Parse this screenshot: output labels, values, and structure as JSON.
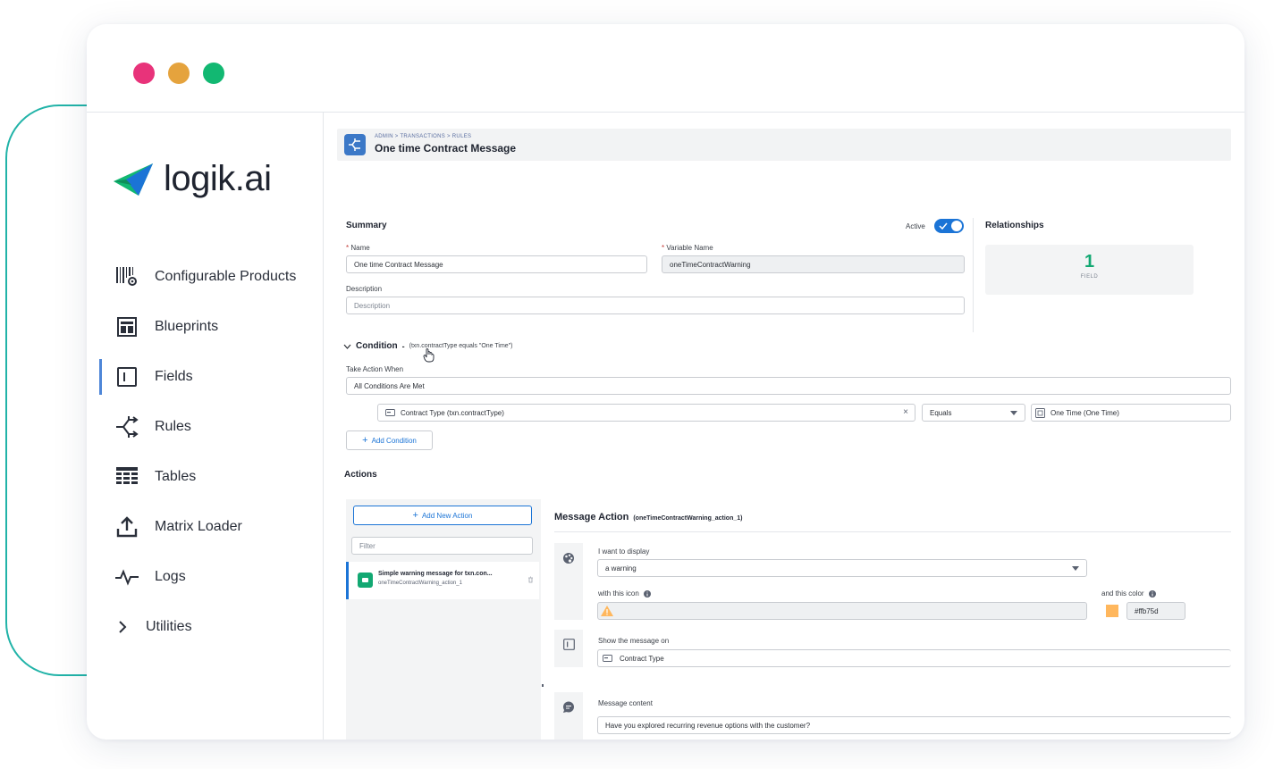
{
  "app": {
    "logo_text": "logik.ai",
    "window_dots": [
      "#e8337a",
      "#e5a33d",
      "#12b872"
    ],
    "accent": "#1b74d6",
    "teal": "#21b3a8"
  },
  "sidebar": {
    "items": [
      {
        "label": "Configurable Products",
        "icon": "barcode-gear-icon"
      },
      {
        "label": "Blueprints",
        "icon": "blueprint-icon"
      },
      {
        "label": "Fields",
        "icon": "field-icon",
        "active": true
      },
      {
        "label": "Rules",
        "icon": "rules-branch-icon"
      },
      {
        "label": "Tables",
        "icon": "table-icon"
      },
      {
        "label": "Matrix Loader",
        "icon": "upload-icon"
      },
      {
        "label": "Logs",
        "icon": "pulse-icon"
      },
      {
        "label": "Utilities",
        "icon": "chevron-right-icon"
      }
    ]
  },
  "header": {
    "breadcrumb": "ADMIN  >  TRANSACTIONS  >  RULES",
    "title": "One time Contract Message"
  },
  "summary": {
    "title": "Summary",
    "active_label": "Active",
    "active": true,
    "name_label": "Name",
    "name_value": "One time Contract Message",
    "variable_label": "Variable Name",
    "variable_value": "oneTimeContractWarning",
    "description_label": "Description",
    "description_placeholder": "Description"
  },
  "relationships": {
    "title": "Relationships",
    "count": "1",
    "count_label": "FIELD"
  },
  "condition": {
    "title": "Condition",
    "separator": "-",
    "expression": "(txn.contractType equals \"One Time\")",
    "take_action_label": "Take Action When",
    "take_action_value": "All Conditions Are Met",
    "field_value": "Contract Type (txn.contractType)",
    "clear_symbol": "×",
    "operator_value": "Equals",
    "compare_value": "One Time (One Time)",
    "add_condition_label": "Add Condition"
  },
  "actions": {
    "title": "Actions",
    "add_new_label": "Add New Action",
    "filter_placeholder": "Filter",
    "list": [
      {
        "title": "Simple warning message for txn.con...",
        "subtitle": "oneTimeContractWarning_action_1"
      }
    ]
  },
  "message_action": {
    "title": "Message Action",
    "id": "(oneTimeContractWarning_action_1)",
    "display_label": "I want to display",
    "display_value": "a warning",
    "icon_label": "with this icon",
    "color_label": "and this color",
    "color_value": "#ffb75d",
    "show_on_label": "Show the message on",
    "show_on_value": "Contract Type",
    "content_label": "Message content",
    "content_value": "Have you explored recurring revenue options with the customer?"
  }
}
